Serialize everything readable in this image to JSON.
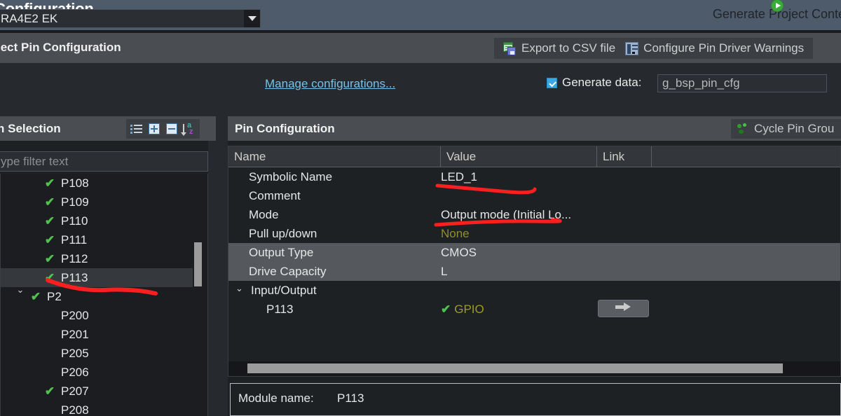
{
  "window": {
    "title": "Configuration",
    "generate_project_label": "Generate Project Conte",
    "generate_project_icon": "green-play-icon"
  },
  "toolbar": {
    "section_title": "lect Pin Configuration",
    "buttons": [
      {
        "label": "Export to CSV file",
        "icon": "csv-export-icon"
      },
      {
        "label": "Configure Pin Driver Warnings",
        "icon": "pin-driver-warnings-icon"
      }
    ]
  },
  "config_row": {
    "board_select_value": "RA4E2 EK",
    "board_select_arrow": "chevron-down-icon",
    "manage_link": "Manage configurations...",
    "generate_data_checked": true,
    "generate_data_label": "Generate data:",
    "generate_data_value": "g_bsp_pin_cfg"
  },
  "pin_selection": {
    "title": "n Selection",
    "toolbar_icons": [
      "list-icon",
      "expand-all-icon",
      "collapse-all-icon",
      "sort-az-icon"
    ],
    "filter_placeholder": "ype filter text",
    "tree": [
      {
        "label": "P108",
        "checked": true,
        "level": 2,
        "selected": false,
        "twisty": ""
      },
      {
        "label": "P109",
        "checked": true,
        "level": 2,
        "selected": false,
        "twisty": ""
      },
      {
        "label": "P110",
        "checked": true,
        "level": 2,
        "selected": false,
        "twisty": ""
      },
      {
        "label": "P111",
        "checked": true,
        "level": 2,
        "selected": false,
        "twisty": ""
      },
      {
        "label": "P112",
        "checked": true,
        "level": 2,
        "selected": false,
        "twisty": ""
      },
      {
        "label": "P113",
        "checked": true,
        "level": 2,
        "selected": true,
        "twisty": ""
      },
      {
        "label": "P2",
        "checked": true,
        "level": 1,
        "selected": false,
        "twisty": "v"
      },
      {
        "label": "P200",
        "checked": false,
        "level": 2,
        "selected": false,
        "twisty": ""
      },
      {
        "label": "P201",
        "checked": false,
        "level": 2,
        "selected": false,
        "twisty": ""
      },
      {
        "label": "P205",
        "checked": false,
        "level": 2,
        "selected": false,
        "twisty": ""
      },
      {
        "label": "P206",
        "checked": false,
        "level": 2,
        "selected": false,
        "twisty": ""
      },
      {
        "label": "P207",
        "checked": true,
        "level": 2,
        "selected": false,
        "twisty": ""
      },
      {
        "label": "P208",
        "checked": false,
        "level": 2,
        "selected": false,
        "twisty": ""
      }
    ]
  },
  "pin_configuration": {
    "title": "Pin Configuration",
    "cycle_button_label": "Cycle Pin Grou",
    "cycle_button_icon": "cycle-pin-group-icon",
    "columns": [
      "Name",
      "Value",
      "Link",
      ""
    ],
    "rows": [
      {
        "name": "Symbolic Name",
        "value": "LED_1",
        "link": "",
        "style": "normal",
        "indent": 1
      },
      {
        "name": "Comment",
        "value": "",
        "link": "",
        "style": "normal",
        "indent": 1
      },
      {
        "name": "Mode",
        "value": "Output mode (Initial Lo...",
        "link": "",
        "style": "normal",
        "indent": 1
      },
      {
        "name": "Pull up/down",
        "value": "None",
        "link": "",
        "style": "olive",
        "indent": 1
      },
      {
        "name": "Output Type",
        "value": "CMOS",
        "link": "",
        "style": "alt",
        "indent": 1
      },
      {
        "name": "Drive Capacity",
        "value": "L",
        "link": "",
        "style": "alt",
        "indent": 1
      },
      {
        "name": "Input/Output",
        "value": "",
        "link": "",
        "style": "group",
        "indent": 0,
        "twisty": "v"
      },
      {
        "name": "P113",
        "value": "GPIO",
        "link": "",
        "style": "gpio",
        "indent": 2,
        "has_check": true,
        "has_arrow_button": true
      }
    ],
    "arrow_button_icon": "right-arrow-icon"
  },
  "module_panel": {
    "label": "Module name:",
    "value": "P113"
  },
  "colors": {
    "title_bar": "#4d5b6b",
    "toolbar": "#4a4e52",
    "panel_bg": "#1e2124",
    "tree_bg": "#1b1d20",
    "accent_link": "#76c2e8",
    "checkmark_green": "#4fc24f",
    "olive_value": "#8f8f2c",
    "annotation_red": "#fb1f1f",
    "checkbox_blue": "#39a8e0",
    "row_alt": "#55595d"
  },
  "annotations": [
    {
      "name": "underline-p113-tree",
      "color": "#fb1f1f"
    },
    {
      "name": "underline-led1-value",
      "color": "#fb1f1f"
    },
    {
      "name": "underline-mode-value",
      "color": "#fb1f1f"
    }
  ]
}
